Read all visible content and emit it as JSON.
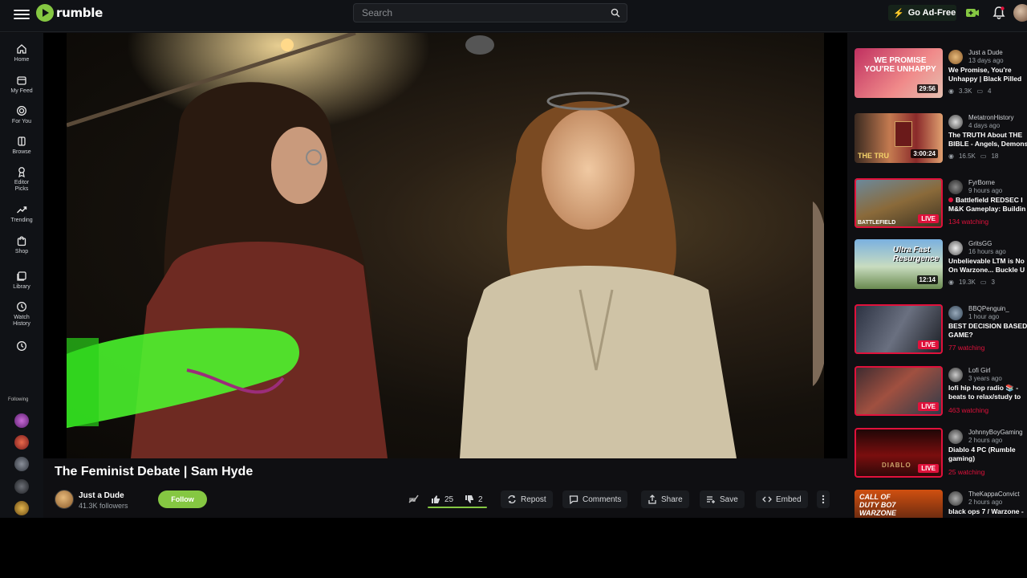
{
  "brand": {
    "name": "rumble",
    "accent": "#85c742",
    "live_color": "#e0113b"
  },
  "header": {
    "search_placeholder": "Search",
    "go_ad_free": "Go Ad-Free"
  },
  "sidebar": {
    "items": [
      {
        "label": "Home",
        "icon": "home-icon"
      },
      {
        "label": "My Feed",
        "icon": "feed-icon"
      },
      {
        "label": "For You",
        "icon": "target-icon"
      },
      {
        "label": "Browse",
        "icon": "browse-icon"
      },
      {
        "label": "Editor Picks",
        "icon": "ribbon-icon"
      },
      {
        "label": "Trending",
        "icon": "trending-icon"
      },
      {
        "label": "Shop",
        "icon": "shop-icon"
      },
      {
        "label": "Library",
        "icon": "library-icon"
      },
      {
        "label": "Watch History",
        "icon": "history-icon"
      }
    ],
    "following_label": "Following"
  },
  "video": {
    "title": "The Feminist Debate | Sam Hyde",
    "channel": "Just a Dude",
    "followers": "41.3K followers",
    "follow_label": "Follow",
    "likes": "25",
    "dislikes": "2",
    "actions": {
      "repost": "Repost",
      "comments": "Comments",
      "share": "Share",
      "save": "Save",
      "embed": "Embed"
    }
  },
  "recommendations": [
    {
      "channel": "Just a Dude",
      "ago": "13 days ago",
      "title1": "We Promise, You're",
      "title2": "Unhappy | Black Pilled",
      "duration": "29:56",
      "views": "3.3K",
      "comments": "4",
      "thumb_text": "WE PROMISE YOU'RE UNHAPPY"
    },
    {
      "channel": "MetatronHistory",
      "ago": "4 days ago",
      "title1": "The TRUTH About THE",
      "title2": "BIBLE - Angels, Demons",
      "duration": "3:00:24",
      "views": "16.5K",
      "comments": "18",
      "thumb_text": "THE TRU"
    },
    {
      "channel": "FyrBorne",
      "ago": "9 hours ago",
      "title1": "Battlefield REDSEC I",
      "title2": "M&K Gameplay: Buildin",
      "live": "LIVE",
      "watching": "134 watching",
      "thumb_text": "BATTLEFIELD"
    },
    {
      "channel": "GritsGG",
      "ago": "16 hours ago",
      "title1": "Unbelievable LTM is No",
      "title2": "On Warzone... Buckle U",
      "duration": "12:14",
      "views": "19.3K",
      "comments": "3",
      "thumb_text": "Ultra Fast Resurgence"
    },
    {
      "channel": "BBQPenguin_",
      "ago": "1 hour ago",
      "title1": "BEST DECISION BASED",
      "title2": "GAME?",
      "live": "LIVE",
      "watching": "77 watching"
    },
    {
      "channel": "Lofi Girl",
      "ago": "3 years ago",
      "title1": "lofi hip hop radio 📚 -",
      "title2": "beats to relax/study to",
      "live": "LIVE",
      "watching": "463 watching"
    },
    {
      "channel": "JohnnyBoyGaming",
      "ago": "2 hours ago",
      "title1": "Diablo 4 PC (Rumble",
      "title2": "gaming)",
      "live": "LIVE",
      "watching": "25 watching",
      "thumb_text": "DIABLO"
    },
    {
      "channel": "TheKappaConvict",
      "ago": "2 hours ago",
      "title1": "black ops 7 / Warzone -",
      "title2": "",
      "thumb_text": "CALL OF DUTY BO7 WARZONE"
    }
  ]
}
